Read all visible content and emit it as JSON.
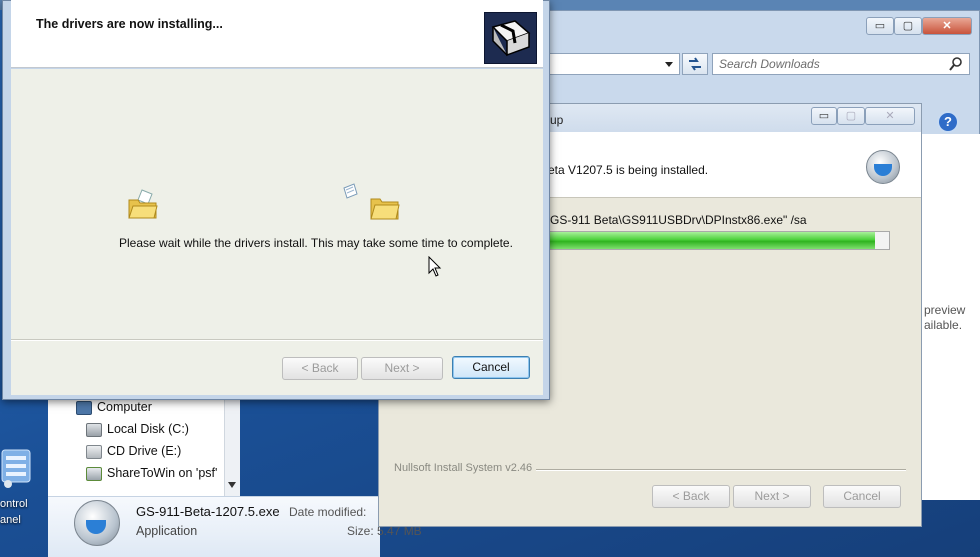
{
  "desktop": {
    "control_panel_label_1": "ontrol",
    "control_panel_label_2": "anel"
  },
  "explorer": {
    "search_placeholder": "Search Downloads",
    "minimize": "▭",
    "maximize": "▢",
    "close": "✕",
    "help": "?",
    "pane_text_1": "preview",
    "pane_text_2": "ailable.",
    "nav_items": [
      {
        "label": "Computer",
        "icon": "computer-icon"
      },
      {
        "label": "Local Disk (C:)",
        "icon": "drive-icon"
      },
      {
        "label": "CD Drive (E:)",
        "icon": "cd-drive-icon"
      },
      {
        "label": "ShareToWin on 'psf'",
        "icon": "network-drive-icon"
      }
    ],
    "details": {
      "file_name": "GS-911-Beta-1207.5.exe",
      "file_type": "Application",
      "date_label": "Date modified:",
      "size_label": "Size:",
      "size_value": "5.47 MB"
    }
  },
  "installer": {
    "title_partial": "up",
    "status_text": "eta V1207.5 is being installed.",
    "command_text": "GS-911 Beta\\GS911USBDrv\\DPInstx86.exe\" /sa",
    "progress_percent": 96,
    "branding": "Nullsoft Install System v2.46",
    "back_label": "< Back",
    "next_label": "Next >",
    "cancel_label": "Cancel"
  },
  "driver_dialog": {
    "heading": "The drivers are now installing...",
    "message": "Please wait while the drivers install. This may take some time to complete.",
    "back_label": "< Back",
    "next_label": "Next >",
    "cancel_label": "Cancel"
  }
}
